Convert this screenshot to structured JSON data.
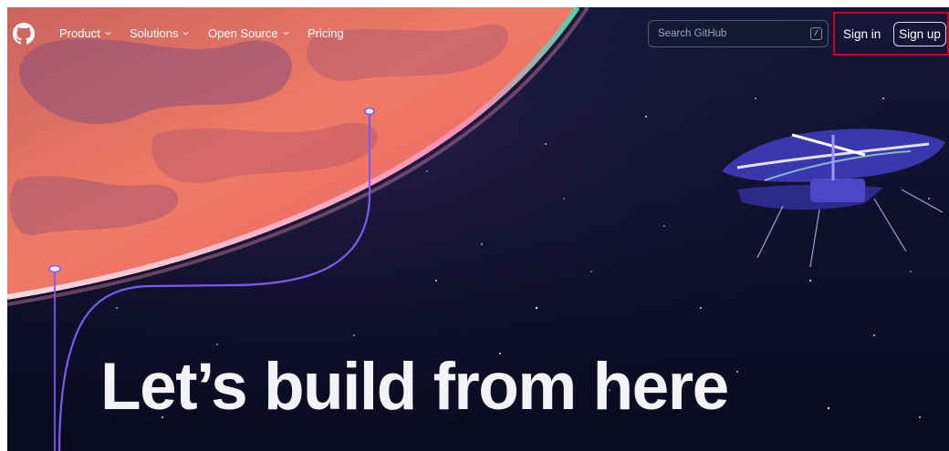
{
  "nav": {
    "items": [
      {
        "label": "Product",
        "has_dropdown": true
      },
      {
        "label": "Solutions",
        "has_dropdown": true
      },
      {
        "label": "Open Source",
        "has_dropdown": true
      },
      {
        "label": "Pricing",
        "has_dropdown": false
      }
    ]
  },
  "search": {
    "placeholder": "Search GitHub",
    "shortcut": "/"
  },
  "auth": {
    "sign_in": "Sign in",
    "sign_up": "Sign up",
    "highlight_color": "#d0021b"
  },
  "hero": {
    "headline": "Let’s build from here"
  },
  "icons": {
    "logo": "github-logo-icon",
    "dropdown": "chevron-down-icon"
  },
  "colors": {
    "background": "#0d0d24",
    "planet": "#e8736a",
    "trace_line": "#7b5cf0",
    "text": "#ffffff"
  }
}
